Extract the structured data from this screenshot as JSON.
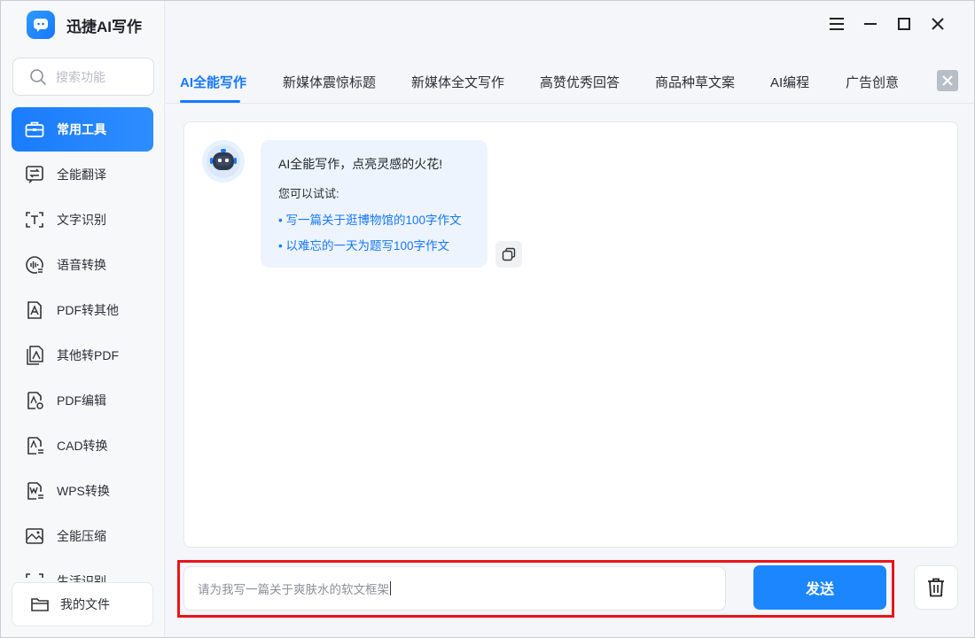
{
  "app": {
    "title": "迅捷AI写作"
  },
  "window_controls": [
    "menu-icon",
    "minimize-icon",
    "maximize-icon",
    "close-icon"
  ],
  "search": {
    "placeholder": "搜索功能"
  },
  "sidebar": {
    "items": [
      {
        "label": "常用工具",
        "icon": "toolbox-icon",
        "active": true
      },
      {
        "label": "全能翻译",
        "icon": "translate-icon"
      },
      {
        "label": "文字识别",
        "icon": "text-recognition-icon"
      },
      {
        "label": "语音转换",
        "icon": "voice-convert-icon"
      },
      {
        "label": "PDF转其他",
        "icon": "pdf-to-other-icon"
      },
      {
        "label": "其他转PDF",
        "icon": "other-to-pdf-icon"
      },
      {
        "label": "PDF编辑",
        "icon": "pdf-edit-icon"
      },
      {
        "label": "CAD转换",
        "icon": "cad-convert-icon"
      },
      {
        "label": "WPS转换",
        "icon": "wps-convert-icon"
      },
      {
        "label": "全能压缩",
        "icon": "compress-icon"
      },
      {
        "label": "生活识别",
        "icon": "life-recognition-icon"
      }
    ],
    "my_files": "我的文件"
  },
  "tabs": [
    {
      "label": "AI全能写作",
      "active": true
    },
    {
      "label": "新媒体震惊标题"
    },
    {
      "label": "新媒体全文写作"
    },
    {
      "label": "高赞优秀回答"
    },
    {
      "label": "商品种草文案"
    },
    {
      "label": "AI编程"
    },
    {
      "label": "广告创意"
    }
  ],
  "chat": {
    "greeting": "AI全能写作，点亮灵感的火花!",
    "try_prompt": "您可以试试:",
    "suggestions": [
      "• 写一篇关于逛博物馆的100字作文",
      "• 以难忘的一天为题写100字作文"
    ]
  },
  "composer": {
    "value": "请为我写一篇关于爽肤水的软文框架",
    "send_label": "发送"
  },
  "colors": {
    "accent": "#1677ff",
    "highlight": "#e8141b"
  }
}
